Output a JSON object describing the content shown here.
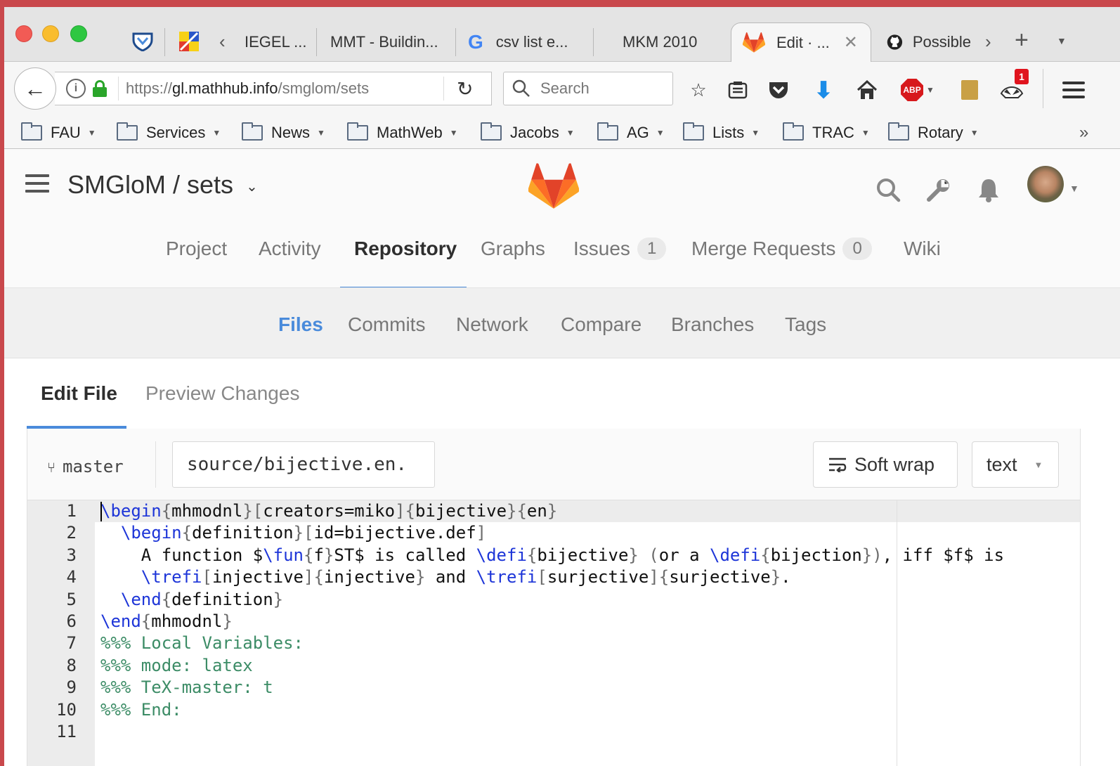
{
  "browser": {
    "tabs": [
      {
        "label": "IEGEL ...",
        "icon": "page-icon"
      },
      {
        "label": "MMT - Buildin...",
        "icon": "page-icon"
      },
      {
        "label": "csv list e...",
        "icon": "google-icon"
      },
      {
        "label": "MKM 2010",
        "icon": "page-icon"
      },
      {
        "label": "Edit · ...",
        "icon": "gitlab-icon",
        "active": true
      },
      {
        "label": "Possible",
        "icon": "github-icon"
      }
    ],
    "url": {
      "scheme": "https://",
      "domain": "gl.mathhub.info",
      "path": "/smglom/sets"
    },
    "search_placeholder": "Search",
    "notification_count": "1",
    "adblock_label": "ABP",
    "bookmarks": [
      "FAU",
      "Services",
      "News",
      "MathWeb",
      "Jacobs",
      "AG",
      "Lists",
      "TRAC",
      "Rotary"
    ]
  },
  "gitlab": {
    "project_title": "SMGloM / sets",
    "nav": [
      {
        "label": "Project"
      },
      {
        "label": "Activity"
      },
      {
        "label": "Repository",
        "active": true
      },
      {
        "label": "Graphs"
      },
      {
        "label": "Issues",
        "count": "1"
      },
      {
        "label": "Merge Requests",
        "count": "0"
      },
      {
        "label": "Wiki"
      }
    ],
    "subnav": [
      "Files",
      "Commits",
      "Network",
      "Compare",
      "Branches",
      "Tags"
    ],
    "active_subnav": "Files"
  },
  "editor": {
    "tabs": {
      "edit": "Edit File",
      "preview": "Preview Changes"
    },
    "branch": "master",
    "file_path": "source/bijective.en.",
    "soft_wrap_label": "Soft wrap",
    "mode_select": "text",
    "lines": [
      "\\begin{mhmodnl}[creators=miko]{bijective}{en}",
      "  \\begin{definition}[id=bijective.def]",
      "    A function $\\fun{f}ST$ is called \\defi{bijective} (or a \\defi{bijection}), iff $f$ is",
      "    \\trefi[injective]{injective} and \\trefi[surjective]{surjective}.",
      "  \\end{definition}",
      "\\end{mhmodnl}",
      "%%% Local Variables:",
      "%%% mode: latex",
      "%%% TeX-master: t",
      "%%% End:",
      ""
    ]
  }
}
